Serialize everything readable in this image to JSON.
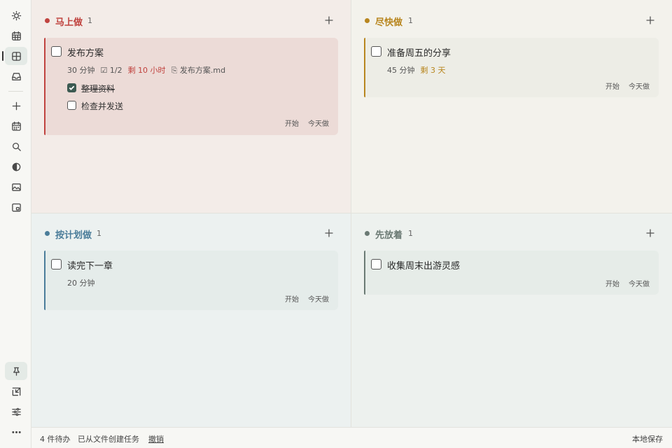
{
  "sidebar": {
    "top": [
      {
        "name": "sun-icon"
      },
      {
        "name": "calendar-icon"
      },
      {
        "name": "grid-icon",
        "active": true
      },
      {
        "name": "inbox-icon"
      }
    ],
    "middle": [
      {
        "name": "plus-icon"
      },
      {
        "name": "calendar-week-icon"
      },
      {
        "name": "search-icon"
      },
      {
        "name": "contrast-icon"
      },
      {
        "name": "image-icon"
      },
      {
        "name": "picture-in-picture-icon"
      }
    ],
    "bottom": [
      {
        "name": "pin-icon",
        "active": true
      },
      {
        "name": "shrink-icon"
      },
      {
        "name": "sliders-icon"
      },
      {
        "name": "more-icon"
      }
    ]
  },
  "quadrants": [
    {
      "title": "马上做",
      "count": "1",
      "color": "#c0433f",
      "cards": [
        {
          "title": "发布方案",
          "meta": {
            "duration": "30 分钟",
            "progress": "☑ 1/2",
            "due": "剩 10 小时",
            "attachment": "⎘ 发布方案.md"
          },
          "subtasks": [
            {
              "label": "整理资料",
              "done": true
            },
            {
              "label": "检查并发送",
              "done": false
            }
          ],
          "start_label": "开始",
          "today_label": "今天做"
        }
      ]
    },
    {
      "title": "尽快做",
      "count": "1",
      "color": "#b8861f",
      "cards": [
        {
          "title": "准备周五的分享",
          "meta": {
            "duration": "45 分钟",
            "due": "剩 3 天"
          },
          "start_label": "开始",
          "today_label": "今天做"
        }
      ]
    },
    {
      "title": "按计划做",
      "count": "1",
      "color": "#4b7d9a",
      "cards": [
        {
          "title": "读完下一章",
          "meta": {
            "duration": "20 分钟"
          },
          "start_label": "开始",
          "today_label": "今天做"
        }
      ]
    },
    {
      "title": "先放着",
      "count": "1",
      "color": "#6b7a74",
      "cards": [
        {
          "title": "收集周末出游灵感",
          "start_label": "开始",
          "today_label": "今天做"
        }
      ]
    }
  ],
  "status": {
    "pending": "4 件待办",
    "message": "已从文件创建任务",
    "undo": "撤销",
    "storage": "本地保存"
  }
}
